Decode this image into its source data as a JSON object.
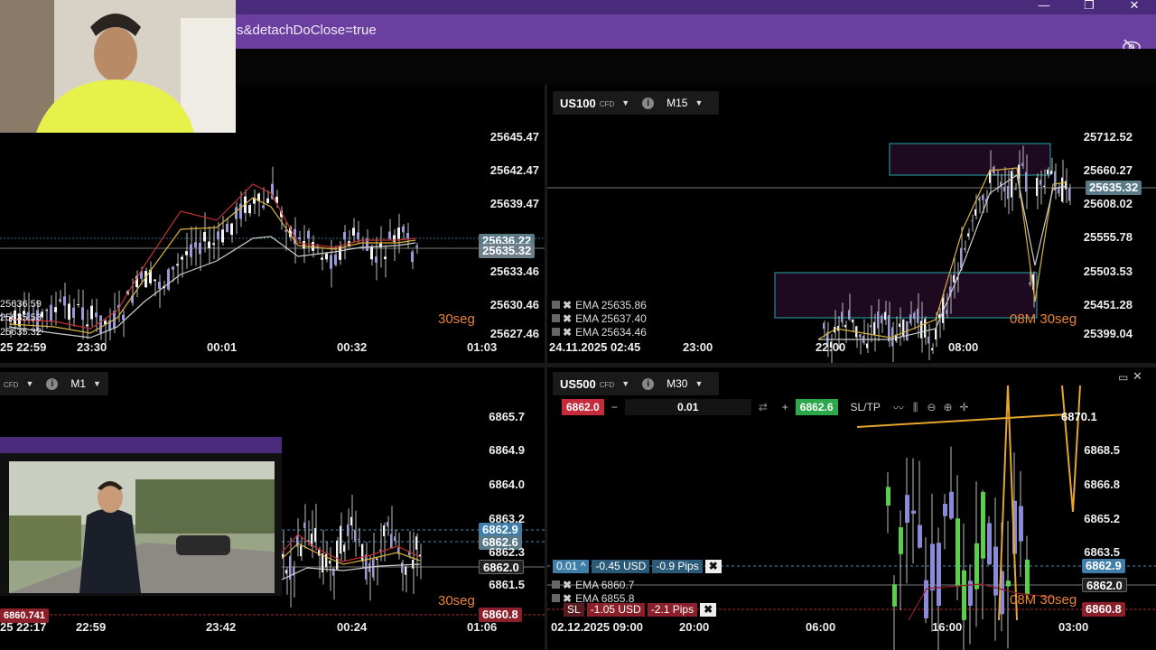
{
  "window": {
    "url_fragment": "s&detachDoClose=true",
    "minimize_icon": "minimize-icon",
    "restore_icon": "restore-icon",
    "close_icon": "close-icon"
  },
  "panels": {
    "top_left": {
      "y_labels": [
        "25645.47",
        "25642.47",
        "25639.47",
        "25636.22",
        "25635.32",
        "25633.46",
        "25630.46",
        "25627.46"
      ],
      "x_labels": [
        "25 22:59",
        "23:30",
        "00:01",
        "00:32",
        "01:03"
      ],
      "left_labels": [
        "25636.59",
        "25635.53",
        "25635.32"
      ],
      "timer": "30seg"
    },
    "top_right": {
      "symbol": "US100",
      "cfd": "CFD",
      "timeframe": "M15",
      "y_labels": [
        "25712.52",
        "25660.27",
        "25635.32",
        "25608.02",
        "25555.78",
        "25503.53",
        "25451.28",
        "25399.04"
      ],
      "x_labels": [
        "24.11.2025 02:45",
        "23:00",
        "22:00",
        "08:00"
      ],
      "ema": [
        "EMA 25635.86",
        "EMA 25637.40",
        "EMA 25634.46"
      ],
      "timer": "08M 30seg"
    },
    "bottom_left": {
      "cfd": "CFD",
      "timeframe": "M1",
      "y_labels": [
        "6865.7",
        "6864.9",
        "6864.0",
        "6863.2",
        "6862.9",
        "6862.6",
        "6862.3",
        "6862.0",
        "6861.5",
        "6860.8"
      ],
      "x_labels": [
        "25 22:17",
        "22:59",
        "23:42",
        "00:24",
        "01:06"
      ],
      "left_label": "6860.741",
      "timer": "30seg"
    },
    "bottom_right": {
      "symbol": "US500",
      "cfd": "CFD",
      "timeframe": "M30",
      "sell_price": "6862.0",
      "buy_price": "6862.6",
      "quantity": "0.01",
      "minus": "−",
      "plus": "+",
      "sltp": "SL/TP",
      "y_labels": [
        "6870.1",
        "6868.5",
        "6866.8",
        "6865.2",
        "6863.5",
        "6862.9",
        "6862.0",
        "6860.8"
      ],
      "x_labels": [
        "02.12.2025 09:00",
        "20:00",
        "06:00",
        "16:00",
        "03:00"
      ],
      "position": {
        "lots": "0.01 ^",
        "pl_usd": "-0.45 USD",
        "pips": "-0.9 Pips"
      },
      "ema": [
        "EMA 6860.7",
        "EMA 6855.8"
      ],
      "sl": {
        "label": "SL",
        "usd": "-1.05 USD",
        "pips": "-2.1 Pips"
      },
      "timer": "08M 30seg"
    }
  },
  "colors": {
    "accent": "#6b3fa0",
    "sell": "#c62b3b",
    "buy": "#2aa84a",
    "timer": "#e8833a"
  }
}
